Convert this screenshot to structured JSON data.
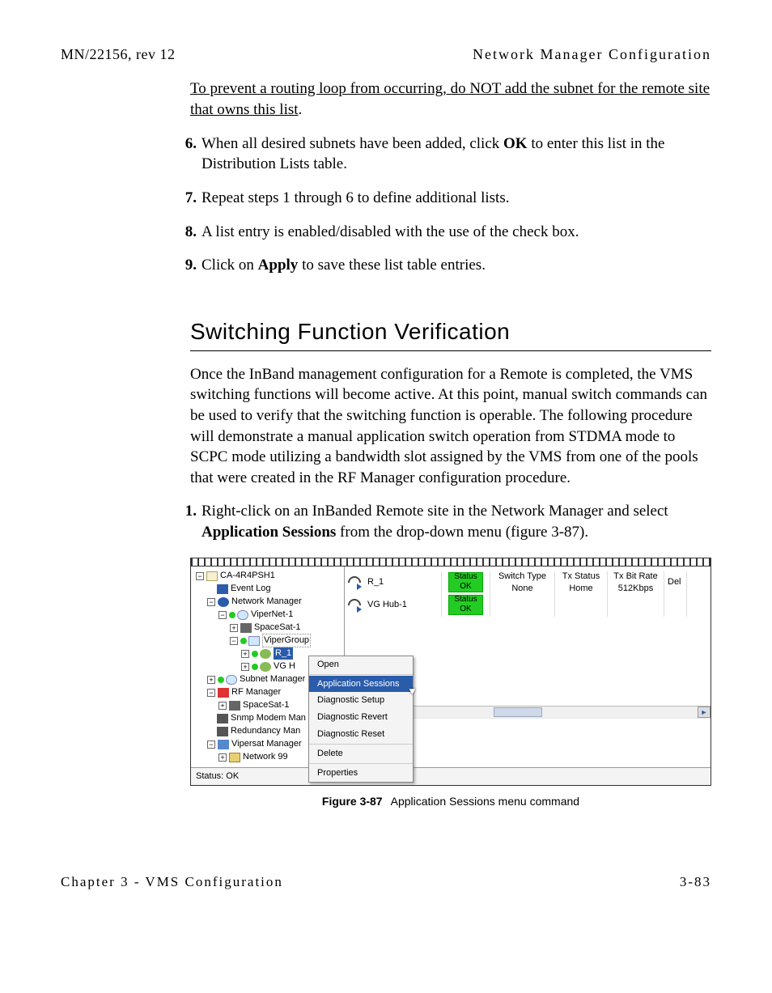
{
  "header": {
    "left": "MN/22156, rev 12",
    "right": "Network Manager Configuration"
  },
  "warning": "To prevent a routing loop from occurring, do NOT add the subnet for the remote site that owns this list",
  "warning_suffix": ".",
  "steps": [
    {
      "n": "6.",
      "pre": "When all desired subnets have been added, click ",
      "bold": "OK",
      "post": " to enter this list in the Distribution Lists table."
    },
    {
      "n": "7.",
      "pre": "Repeat steps 1 through 6 to define additional lists.",
      "bold": "",
      "post": ""
    },
    {
      "n": "8.",
      "pre": "A list entry is enabled/disabled with the use of the check box.",
      "bold": "",
      "post": ""
    },
    {
      "n": "9.",
      "pre": "Click on ",
      "bold": "Apply",
      "post": " to save these list table entries."
    }
  ],
  "section": {
    "title": "Switching Function Verification",
    "para": "Once the InBand management configuration for a Remote is completed, the VMS switching functions will become active. At this point, manual switch commands can be used to verify that the switching function is operable. The following procedure will demonstrate a manual application switch operation from STDMA mode to SCPC mode utilizing a bandwidth slot assigned by the VMS from one of the pools that were created in the RF Manager configuration procedure."
  },
  "procstep": {
    "n": "1.",
    "pre": "Right-click on an InBanded Remote site in the Network Manager and select ",
    "bold": "Application Sessions",
    "post": " from the drop-down menu (figure 3-87)."
  },
  "tree": {
    "root": "CA-4R4PSH1",
    "eventlog": "Event Log",
    "netmgr": "Network Manager",
    "vipernet": "ViperNet-1",
    "spacesat": "SpaceSat-1",
    "vipergroup": "ViperGroup",
    "r1": "R_1",
    "vgh": "VG H",
    "subnet": "Subnet Manager",
    "rfman": "RF Manager",
    "spacesat2": "SpaceSat-1",
    "snmp": "Snmp Modem Man",
    "redun": "Redundancy Man",
    "vipmgr": "Vipersat Manager",
    "net99": "Network 99"
  },
  "ctx": {
    "open": "Open",
    "appsess": "Application Sessions",
    "diagsetup": "Diagnostic Setup",
    "diagrevert": "Diagnostic Revert",
    "diagreset": "Diagnostic Reset",
    "delete": "Delete",
    "props": "Properties"
  },
  "grid": {
    "cols": {
      "status": "Status",
      "swtype": "Switch Type",
      "txstatus": "Tx Status",
      "txbitrate": "Tx Bit Rate",
      "de": "Del"
    },
    "r1": {
      "name": "R_1",
      "status": "Status",
      "ok": "OK",
      "swtype": "None",
      "txstatus": "Home",
      "txbitrate": "512Kbps"
    },
    "r2": {
      "name": "VG Hub-1",
      "status": "Status",
      "ok": "OK"
    }
  },
  "statusbar": "Status: OK",
  "figcap": {
    "num": "Figure 3-87",
    "text": "Application Sessions menu command"
  },
  "footer": {
    "left": "Chapter 3 - VMS Configuration",
    "right": "3-83"
  }
}
